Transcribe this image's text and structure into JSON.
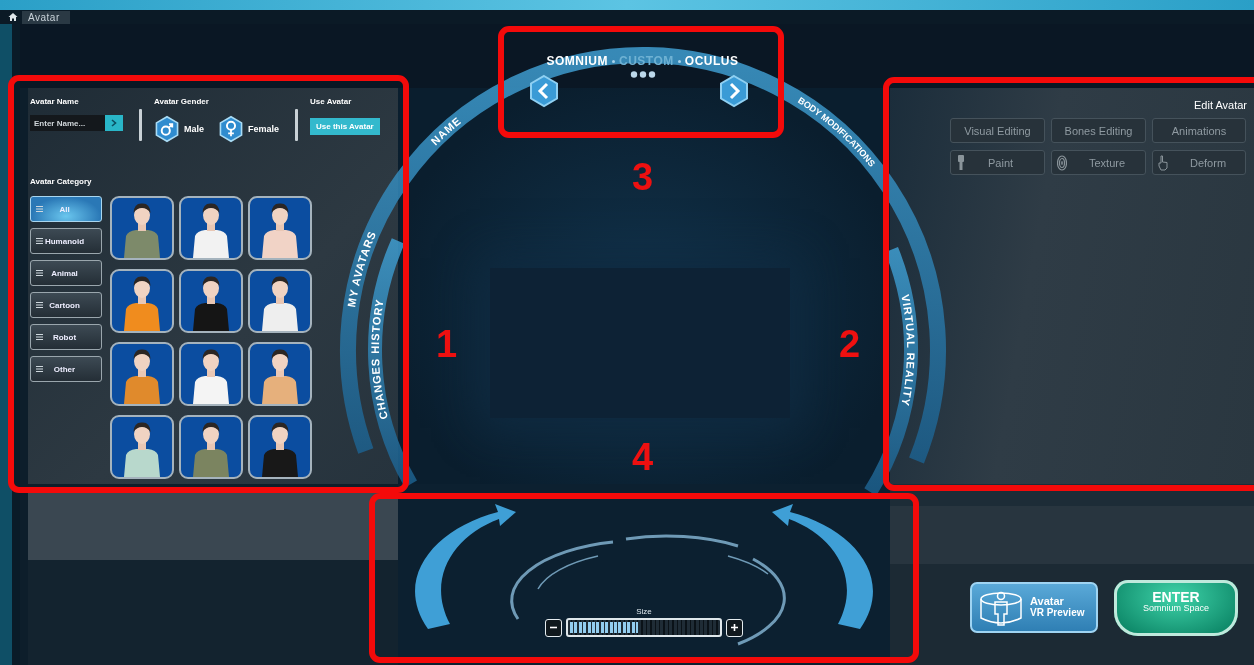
{
  "breadcrumb": {
    "title": "Avatar"
  },
  "avatar_name": {
    "label": "Avatar Name",
    "placeholder": "Enter Name..."
  },
  "gender": {
    "label": "Avatar Gender",
    "options": [
      {
        "label": "Male",
        "kind": "male"
      },
      {
        "label": "Female",
        "kind": "female"
      }
    ]
  },
  "use_avatar": {
    "label": "Use Avatar",
    "button": "Use this Avatar"
  },
  "category": {
    "label": "Avatar Category",
    "items": [
      {
        "label": "All",
        "selected": true
      },
      {
        "label": "Humanoid",
        "selected": false
      },
      {
        "label": "Animal",
        "selected": false
      },
      {
        "label": "Cartoon",
        "selected": false
      },
      {
        "label": "Robot",
        "selected": false
      },
      {
        "label": "Other",
        "selected": false
      }
    ]
  },
  "avatars": [
    {
      "color": "#7d8a6a"
    },
    {
      "color": "#f2f2f2"
    },
    {
      "color": "#f1d3c6"
    },
    {
      "color": "#f08c1e"
    },
    {
      "color": "#151515"
    },
    {
      "color": "#eeeeee"
    },
    {
      "color": "#e08a2c"
    },
    {
      "color": "#f4f4f4"
    },
    {
      "color": "#e6b07c"
    },
    {
      "color": "#b8d8cc"
    },
    {
      "color": "#7b8460"
    },
    {
      "color": "#181818"
    }
  ],
  "ring_labels": [
    {
      "label": "NAME",
      "kind": "outer"
    },
    {
      "label": "MY AVATARS",
      "kind": "outer"
    },
    {
      "label": "CHANGES HISTORY",
      "kind": "inner"
    },
    {
      "label": "BODY MODIFICATIONS",
      "kind": "outer"
    },
    {
      "label": "VIRTUAL REALITY",
      "kind": "inner"
    }
  ],
  "platform_selector": {
    "options": [
      {
        "label": "SOMNIUM",
        "selected": false
      },
      {
        "label": "CUSTOM",
        "selected": true
      },
      {
        "label": "OCULUS",
        "selected": false
      }
    ]
  },
  "edit_avatar": {
    "title": "Edit Avatar",
    "modes": [
      {
        "label": "Visual Editing"
      },
      {
        "label": "Bones Editing"
      },
      {
        "label": "Animations"
      }
    ],
    "tools": [
      {
        "label": "Paint",
        "kind": "brush"
      },
      {
        "label": "Texture",
        "kind": "fingerprint"
      },
      {
        "label": "Deform",
        "kind": "hand"
      }
    ]
  },
  "size": {
    "label": "Size",
    "level": 0.46
  },
  "vr_preview_button": {
    "title": "Avatar",
    "subtitle": "VR Preview"
  },
  "enter_button": {
    "title": "ENTER",
    "subtitle": "Somnium Space"
  },
  "annotations": [
    {
      "label": "1"
    },
    {
      "label": "2"
    },
    {
      "label": "3"
    },
    {
      "label": "4"
    }
  ]
}
